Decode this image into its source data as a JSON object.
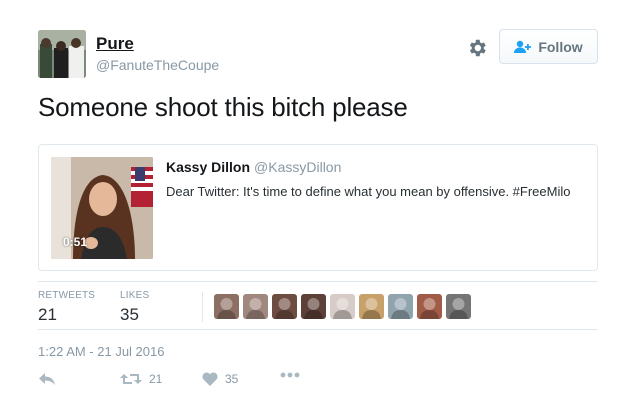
{
  "author": {
    "name": "Pure",
    "handle": "@FanuteTheCoupe"
  },
  "follow_label": "Follow",
  "tweet_text": "Someone shoot this bitch please",
  "quoted_tweet": {
    "name": "Kassy Dillon",
    "handle": "@KassyDillon",
    "text": "Dear Twitter: It's time to define what you mean by offensive. #FreeMilo",
    "video_duration": "0:51"
  },
  "stats": {
    "retweets_label": "RETWEETS",
    "retweets_count": "21",
    "likes_label": "LIKES",
    "likes_count": "35"
  },
  "likers": [
    {
      "color": "#8d6e63"
    },
    {
      "color": "#a1887f"
    },
    {
      "color": "#6d4c41"
    },
    {
      "color": "#5d4037"
    },
    {
      "color": "#d7ccc8"
    },
    {
      "color": "#c8a06a"
    },
    {
      "color": "#90a4ae"
    },
    {
      "color": "#a15c48"
    },
    {
      "color": "#757575"
    }
  ],
  "timestamp": "1:22 AM - 21 Jul 2016",
  "actions": {
    "retweet_count": "21",
    "like_count": "35"
  },
  "colors": {
    "text_primary": "#14171a",
    "text_secondary": "#8899a6",
    "border": "#e1e8ed",
    "follow_icon": "#1da1f2"
  },
  "icons": [
    "gear-icon",
    "follow-user-icon",
    "reply-icon",
    "retweet-icon",
    "heart-icon",
    "more-icon"
  ]
}
